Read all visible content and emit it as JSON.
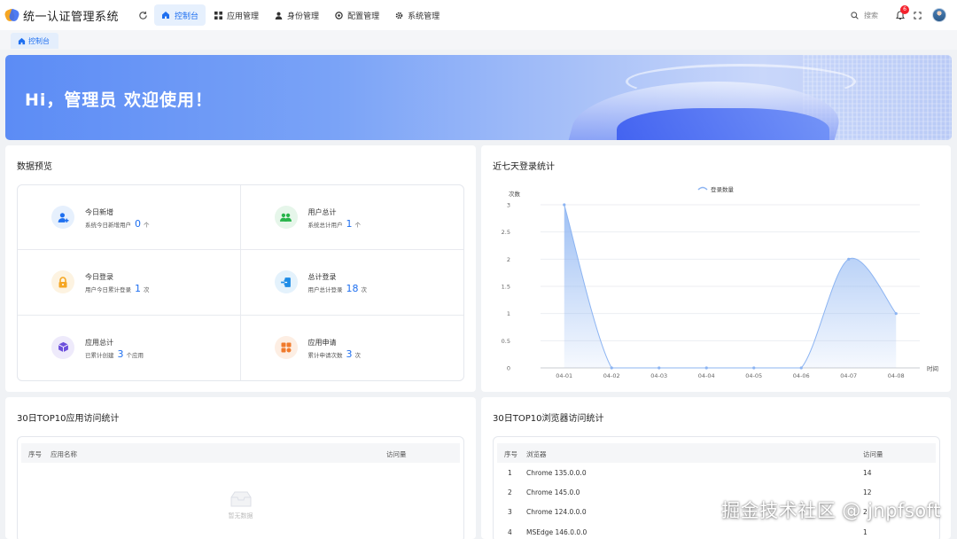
{
  "app": {
    "title": "统一认证管理系统"
  },
  "nav": {
    "items": [
      {
        "label": "控制台",
        "active": true
      },
      {
        "label": "应用管理",
        "active": false
      },
      {
        "label": "身份管理",
        "active": false
      },
      {
        "label": "配置管理",
        "active": false
      },
      {
        "label": "系统管理",
        "active": false
      }
    ]
  },
  "header": {
    "search_label": "搜索",
    "notification_count": "6"
  },
  "tabs": [
    {
      "label": "控制台"
    }
  ],
  "banner": {
    "greeting": "Hi，管理员 欢迎使用！"
  },
  "stats": {
    "title": "数据预览",
    "items": [
      {
        "title": "今日新增",
        "desc_prefix": "系统今日新增用户",
        "value": "0",
        "unit": "个",
        "icon": "user-add-icon",
        "color": "#1e6ff0"
      },
      {
        "title": "用户总计",
        "desc_prefix": "系统总计用户",
        "value": "1",
        "unit": "个",
        "icon": "users-icon",
        "color": "#27b44a"
      },
      {
        "title": "今日登录",
        "desc_prefix": "用户今日累计登录",
        "value": "1",
        "unit": "次",
        "icon": "lock-icon",
        "color": "#f5a623"
      },
      {
        "title": "总计登录",
        "desc_prefix": "用户总计登录",
        "value": "18",
        "unit": "次",
        "icon": "login-icon",
        "color": "#1e8ce6"
      },
      {
        "title": "应用总计",
        "desc_prefix": "已累计创建",
        "value": "3",
        "unit": "个应用",
        "icon": "cube-icon",
        "color": "#6c4fdc"
      },
      {
        "title": "应用申请",
        "desc_prefix": "累计申请次数",
        "value": "3",
        "unit": "次",
        "icon": "apps-icon",
        "color": "#f07a2c"
      }
    ]
  },
  "login_chart": {
    "title": "近七天登录统计",
    "chart_data": {
      "type": "area",
      "title": "近七天登录统计",
      "xlabel": "时间",
      "ylabel": "次数",
      "categories": [
        "04-01",
        "04-02",
        "04-03",
        "04-04",
        "04-05",
        "04-06",
        "04-07",
        "04-08"
      ],
      "series": [
        {
          "name": "登录数量",
          "values": [
            3,
            0,
            0,
            0,
            0,
            0,
            2,
            1
          ]
        }
      ],
      "ylim": [
        0,
        3
      ],
      "yticks": [
        "0",
        "0.5",
        "1",
        "1.5",
        "2",
        "2.5",
        "3"
      ],
      "grid": true,
      "legend": "top-center",
      "color": "#8cb4f2"
    }
  },
  "apps_table": {
    "title": "30日TOP10应用访问统计",
    "columns": [
      "序号",
      "应用名称",
      "访问量"
    ],
    "rows": [],
    "empty_text": "暂无数据"
  },
  "browser_table": {
    "title": "30日TOP10浏览器访问统计",
    "columns": [
      "序号",
      "浏览器",
      "访问量"
    ],
    "rows": [
      [
        "1",
        "Chrome 135.0.0.0",
        "14"
      ],
      [
        "2",
        "Chrome 145.0.0",
        "12"
      ],
      [
        "3",
        "Chrome 124.0.0.0",
        "2"
      ],
      [
        "4",
        "MSEdge 146.0.0.0",
        "1"
      ]
    ]
  },
  "watermark": "掘金技术社区 @ jnpfsoft"
}
